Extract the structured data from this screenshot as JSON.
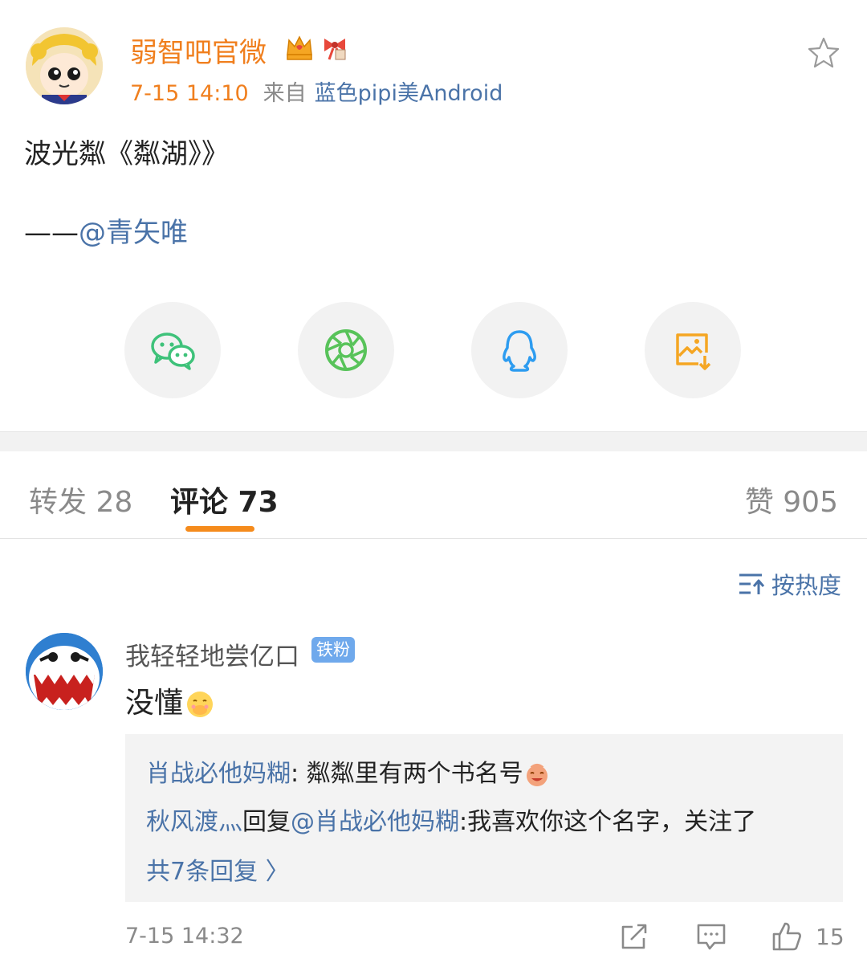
{
  "post": {
    "username": "弱智吧官微",
    "time": "7-15 14:10",
    "from_label": "来自",
    "device": "蓝色pipi美Android",
    "text": "波光粼《粼湖》》",
    "credit_dash": "——",
    "credit_mention": "@青矢唯"
  },
  "share_icons": [
    "wechat-icon",
    "moments-icon",
    "qq-icon",
    "save-image-icon"
  ],
  "tabs": {
    "repost": "转发 28",
    "comment": "评论 73",
    "like": "赞 905"
  },
  "sort_label": "按热度",
  "comment": {
    "username": "我轻轻地尝亿口",
    "badge": "铁粉",
    "text": "没懂",
    "replies": [
      {
        "name": "肖战必他妈糊",
        "sep": ": ",
        "text": "粼粼里有两个书名号"
      },
      {
        "name": "秋风渡灬",
        "mid": "回复",
        "mention": "@肖战必他妈糊",
        "sep": ":",
        "text": "我喜欢你这个名字，关注了"
      }
    ],
    "more_replies": "共7条回复 〉",
    "time": "7-15 14:32",
    "likes": "15"
  },
  "colors": {
    "username": "#f07f1e",
    "link": "#4a73a8",
    "accent": "#f58b1c",
    "badge": "#6fa9ec"
  }
}
